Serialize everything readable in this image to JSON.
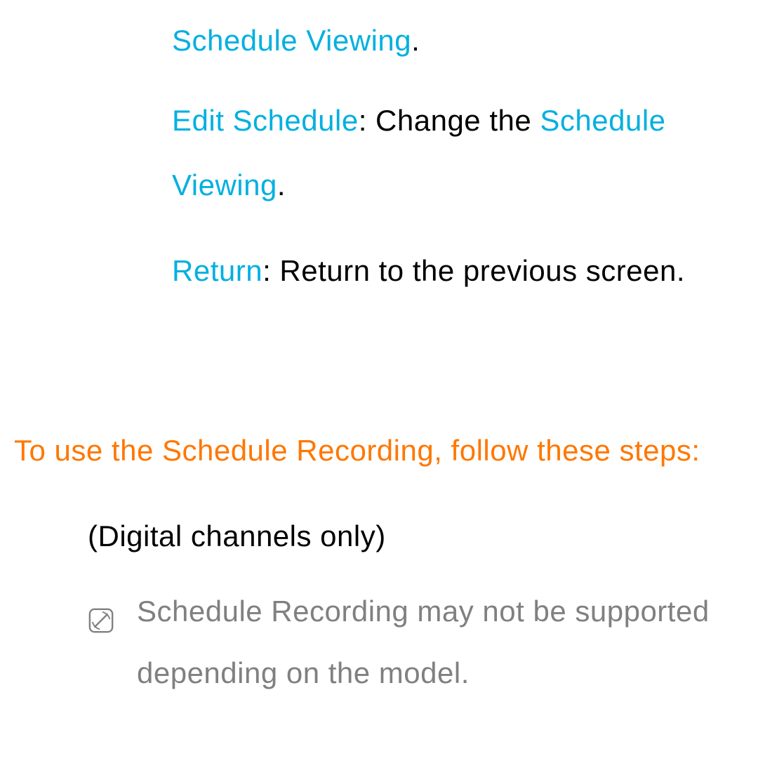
{
  "line1": {
    "term": "Schedule Viewing",
    "suffix": "."
  },
  "line2": {
    "term": "Edit Schedule",
    "colon": ": ",
    "desc_pre": "Change the ",
    "term2": "Schedule Viewing",
    "suffix": "."
  },
  "line3": {
    "term": "Return",
    "colon": ": ",
    "desc": "Return to the previous screen."
  },
  "heading": "To use the Schedule Recording, follow these steps:",
  "note1": "(Digital channels only)",
  "note2": "Schedule Recording may not be supported depending on the model."
}
